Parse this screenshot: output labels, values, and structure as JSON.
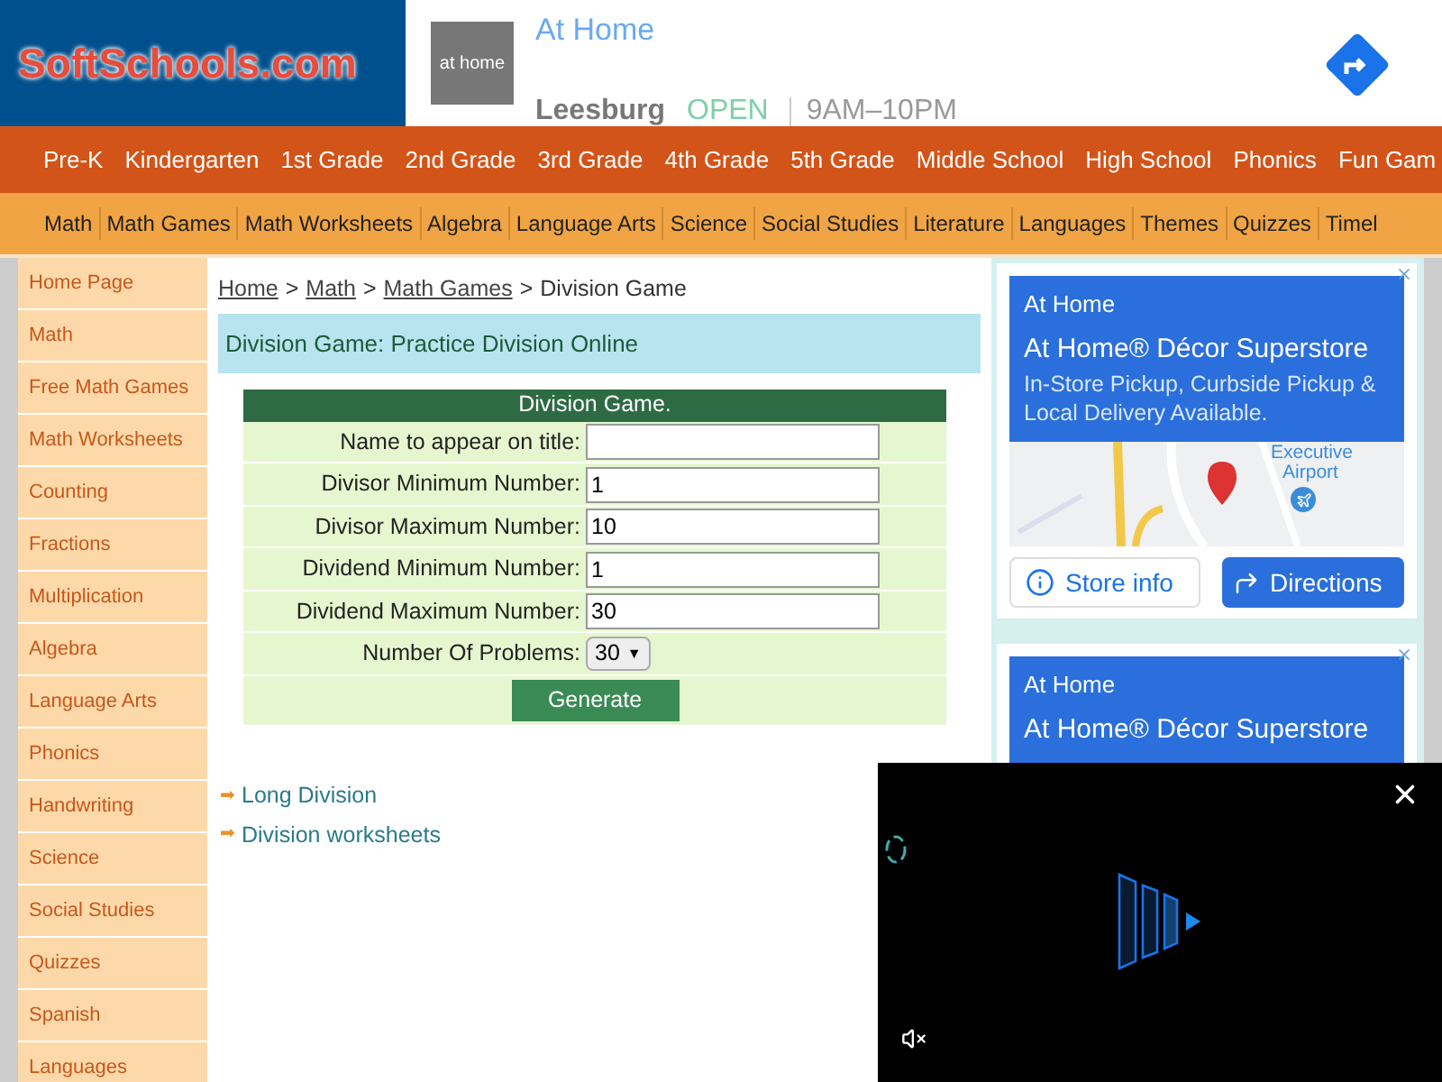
{
  "header": {
    "logo": "SoftSchools.com",
    "ad": {
      "brand": "At Home",
      "logo_text": "at home",
      "city": "Leesburg",
      "status": "OPEN",
      "hours": "9AM–10PM"
    }
  },
  "grade_nav": [
    "Pre-K",
    "Kindergarten",
    "1st Grade",
    "2nd Grade",
    "3rd Grade",
    "4th Grade",
    "5th Grade",
    "Middle School",
    "High School",
    "Phonics",
    "Fun Gam"
  ],
  "subject_nav": [
    "Math",
    "Math Games",
    "Math Worksheets",
    "Algebra",
    "Language Arts",
    "Science",
    "Social Studies",
    "Literature",
    "Languages",
    "Themes",
    "Quizzes",
    "Timel"
  ],
  "sidebar": {
    "items": [
      "Home Page",
      "Math",
      "Free Math Games",
      "Math Worksheets",
      "Counting",
      "Fractions",
      "Multiplication",
      "Algebra",
      "Language Arts",
      "Phonics",
      "Handwriting",
      "Science",
      "Social Studies",
      "Quizzes",
      "Spanish",
      "Languages"
    ]
  },
  "breadcrumb": {
    "links": [
      "Home",
      "Math",
      "Math Games"
    ],
    "separator": ">",
    "current": "Division Game"
  },
  "page_title": "Division Game: Practice Division Online",
  "form": {
    "title": "Division Game.",
    "fields": [
      {
        "kind": "text",
        "label": "Name to appear on title:"
      },
      {
        "kind": "text",
        "label": "Divisor Minimum Number:",
        "value": "1"
      },
      {
        "kind": "text",
        "label": "Divisor Maximum Number:",
        "value": "10"
      },
      {
        "kind": "text",
        "label": "Dividend Minimum Number:",
        "value": "1"
      },
      {
        "kind": "text",
        "label": "Dividend Maximum Number:",
        "value": "30"
      },
      {
        "kind": "select",
        "label": "Number Of Problems:",
        "value": "30",
        "caret": "▼"
      }
    ],
    "submit": "Generate"
  },
  "related_links": [
    {
      "bullet": "➡",
      "label": "Long Division"
    },
    {
      "bullet": "➡",
      "label": "Division worksheets"
    }
  ],
  "side_ads": [
    {
      "brand": "At Home",
      "headline": "At Home® Décor Superstore",
      "body": "In-Store Pickup, Curbside Pickup & Local Delivery Available.",
      "map_label": "Executive Airport",
      "buttons": [
        "Store info",
        "Directions"
      ]
    },
    {
      "brand": "At Home",
      "headline": "At Home® Décor Superstore"
    }
  ],
  "video_player": {
    "muted": true
  }
}
